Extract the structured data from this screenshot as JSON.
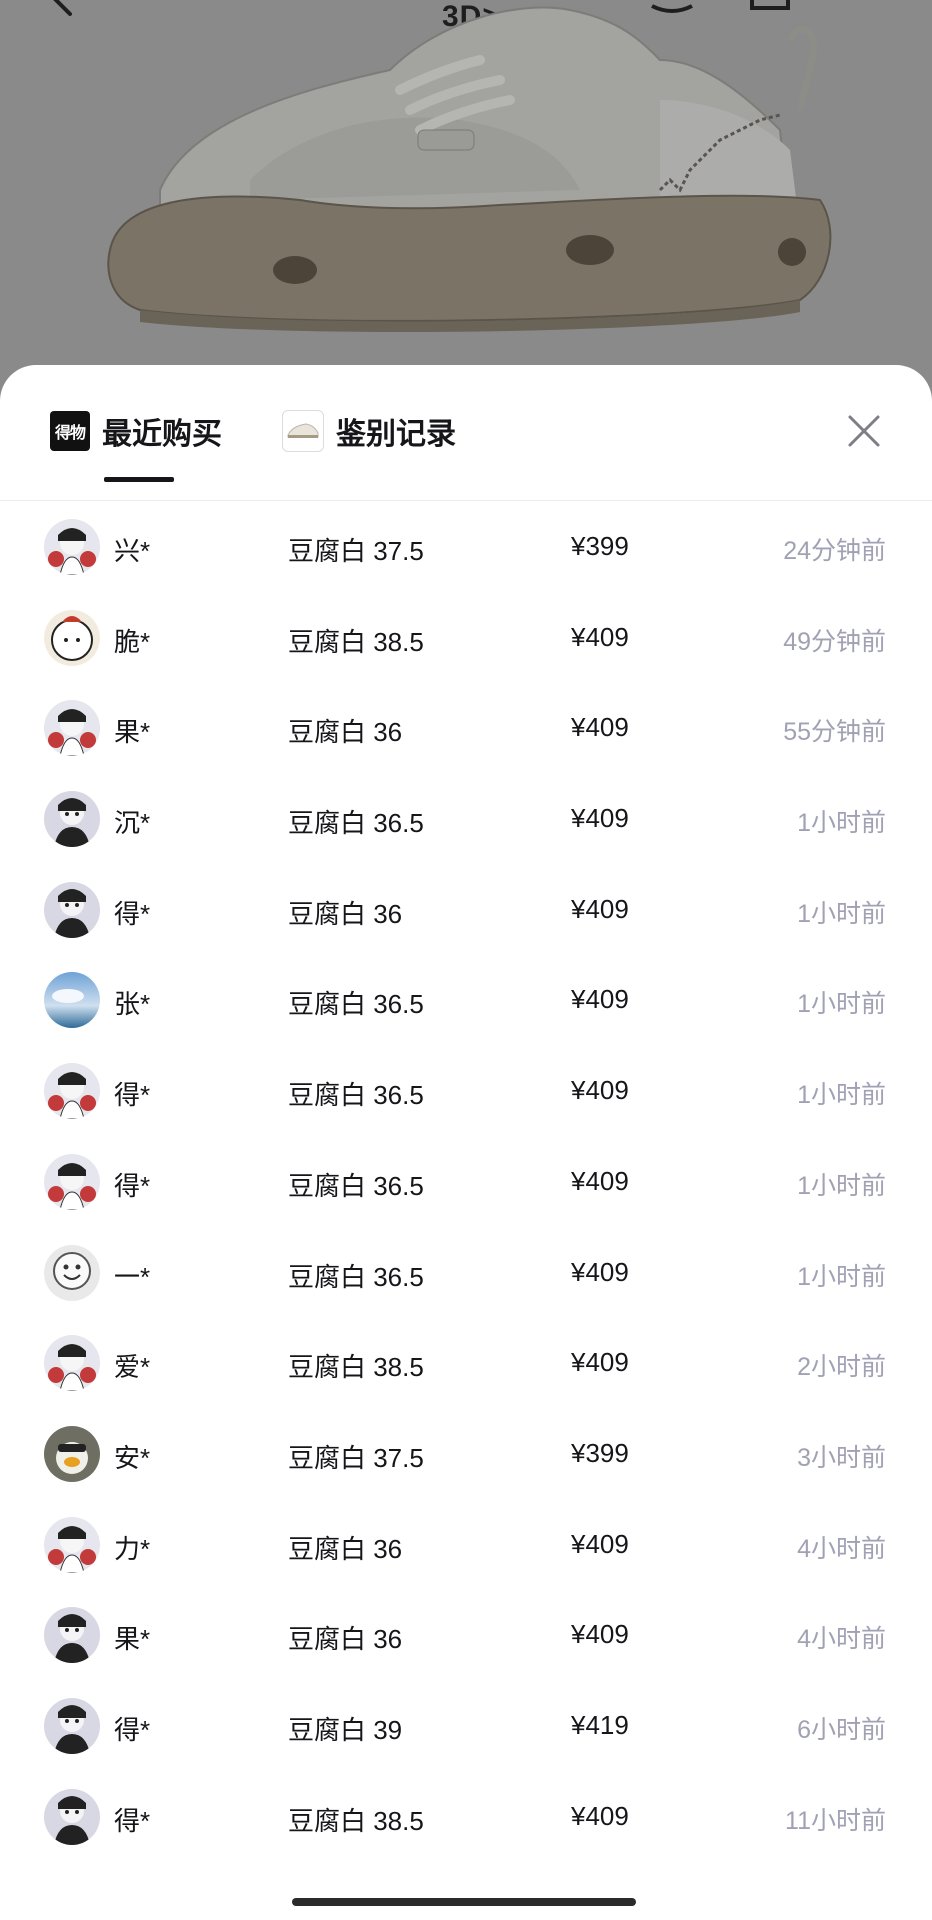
{
  "header": {
    "view_3d_label": "3D>"
  },
  "tabs": [
    {
      "logo_text": "得物",
      "label": "最近购买"
    },
    {
      "label": "鉴别记录"
    }
  ],
  "purchases": [
    {
      "name": "兴*",
      "variant": "豆腐白 37.5",
      "price": "¥399",
      "time": "24分钟前",
      "avatar": "cartoon-red-avatar"
    },
    {
      "name": "脆*",
      "variant": "豆腐白 38.5",
      "price": "¥409",
      "time": "49分钟前",
      "avatar": "cartoon-face-avatar"
    },
    {
      "name": "果*",
      "variant": "豆腐白 36",
      "price": "¥409",
      "time": "55分钟前",
      "avatar": "cartoon-red-avatar"
    },
    {
      "name": "沉*",
      "variant": "豆腐白 36.5",
      "price": "¥409",
      "time": "1小时前",
      "avatar": "cartoon-avatar"
    },
    {
      "name": "得*",
      "variant": "豆腐白 36",
      "price": "¥409",
      "time": "1小时前",
      "avatar": "cartoon-avatar"
    },
    {
      "name": "张*",
      "variant": "豆腐白 36.5",
      "price": "¥409",
      "time": "1小时前",
      "avatar": "sky-photo-avatar"
    },
    {
      "name": "得*",
      "variant": "豆腐白 36.5",
      "price": "¥409",
      "time": "1小时前",
      "avatar": "cartoon-red-avatar"
    },
    {
      "name": "得*",
      "variant": "豆腐白 36.5",
      "price": "¥409",
      "time": "1小时前",
      "avatar": "cartoon-red-avatar"
    },
    {
      "name": "一*",
      "variant": "豆腐白 36.5",
      "price": "¥409",
      "time": "1小时前",
      "avatar": "smiley-avatar"
    },
    {
      "name": "爱*",
      "variant": "豆腐白 38.5",
      "price": "¥409",
      "time": "2小时前",
      "avatar": "cartoon-red-avatar"
    },
    {
      "name": "安*",
      "variant": "豆腐白 37.5",
      "price": "¥399",
      "time": "3小时前",
      "avatar": "duck-avatar"
    },
    {
      "name": "力*",
      "variant": "豆腐白 36",
      "price": "¥409",
      "time": "4小时前",
      "avatar": "cartoon-red-avatar"
    },
    {
      "name": "果*",
      "variant": "豆腐白 36",
      "price": "¥409",
      "time": "4小时前",
      "avatar": "cartoon-avatar"
    },
    {
      "name": "得*",
      "variant": "豆腐白 39",
      "price": "¥419",
      "time": "6小时前",
      "avatar": "cartoon-avatar"
    },
    {
      "name": "得*",
      "variant": "豆腐白 38.5",
      "price": "¥409",
      "time": "11小时前",
      "avatar": "cartoon-avatar"
    }
  ],
  "colors": {
    "text_primary": "#16161a",
    "text_secondary": "#a1a1b4",
    "overlay": "#8a8a8a"
  }
}
